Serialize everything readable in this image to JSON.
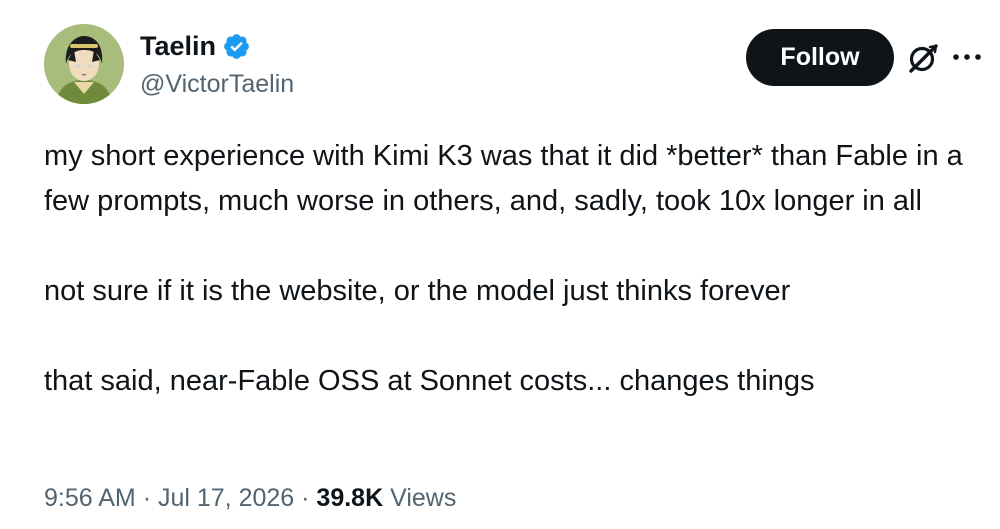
{
  "author": {
    "display_name": "Taelin",
    "handle": "@VictorTaelin",
    "verified_icon": "verified-badge-icon",
    "avatar_icon": "avatar-illustration"
  },
  "actions": {
    "follow_label": "Follow",
    "grok_icon": "grok-icon",
    "more_icon": "more-options-icon"
  },
  "tweet": {
    "paragraphs": [
      "my short experience with Kimi K3 was that it did *better* than Fable in a few prompts, much worse in others, and, sadly, took 10x longer in all",
      "not sure if it is the website, or the model just thinks forever",
      "that said, near-Fable OSS at Sonnet costs... changes things"
    ]
  },
  "meta": {
    "time": "9:56 AM",
    "separator": "·",
    "date": "Jul 17, 2026",
    "views_count": "39.8K",
    "views_label": "Views"
  },
  "colors": {
    "text": "#0f1419",
    "secondary": "#536471",
    "verified": "#1d9bf0",
    "follow_bg": "#0f1419",
    "follow_text": "#ffffff"
  }
}
